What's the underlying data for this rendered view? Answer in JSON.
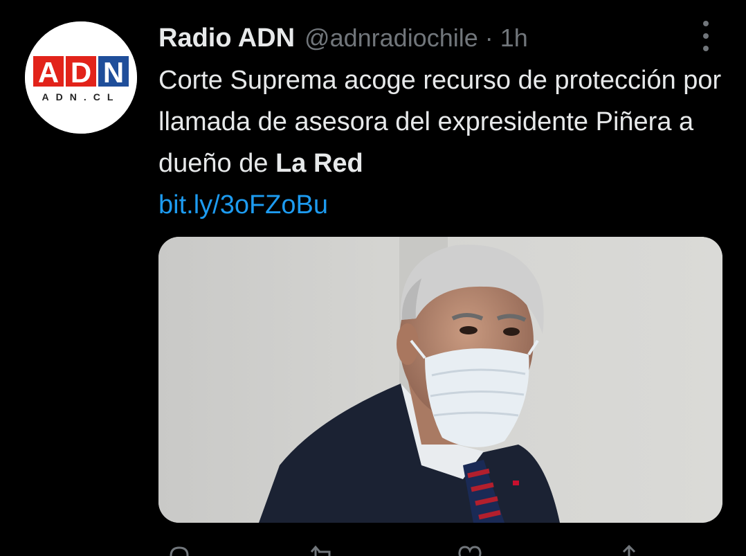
{
  "tweet": {
    "author": {
      "display_name": "Radio ADN",
      "handle": "@adnradiochile",
      "separator": "·",
      "time": "1h",
      "avatar": {
        "logo_text": "ADN",
        "logo_sub": "ADN.CL",
        "colors": {
          "red": "#e2231a",
          "blue": "#1f4e9a"
        }
      }
    },
    "text": {
      "main": "Corte Suprema acoge recurso de protección por llamada de asesora del expresidente Piñera a dueño de ",
      "bold": "La Red",
      "link": "bit.ly/3oFZoBu"
    },
    "more_icon": "more-vertical-icon",
    "actions": [
      {
        "icon": "reply-icon",
        "count": ""
      },
      {
        "icon": "retweet-icon",
        "count": ""
      },
      {
        "icon": "like-icon",
        "count": ""
      },
      {
        "icon": "share-icon",
        "count": ""
      }
    ]
  },
  "colors": {
    "background": "#000000",
    "text_primary": "#e7e9ea",
    "text_secondary": "#71767b",
    "link": "#1d9bf0"
  }
}
